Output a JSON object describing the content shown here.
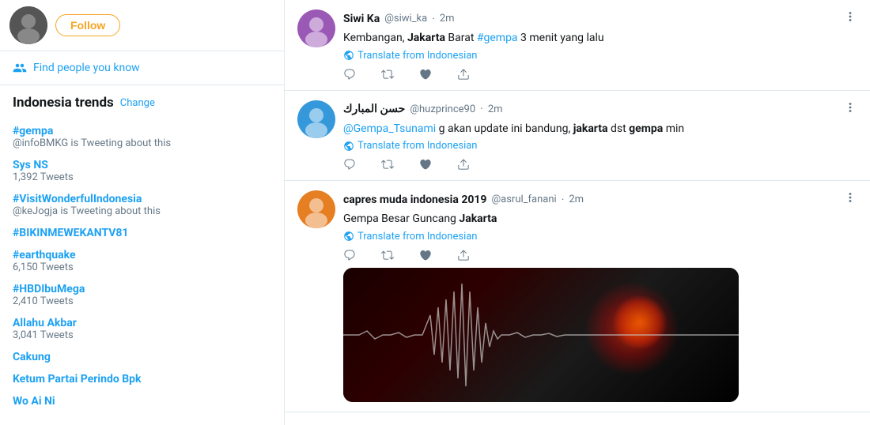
{
  "sidebar": {
    "follow_button": "Follow",
    "find_people": "Find people you know",
    "trends_title": "Indonesia trends",
    "trends_change": "Change",
    "trends": [
      {
        "label": "#gempa",
        "type": "hashtag",
        "sub": "@infoBMKG is Tweeting about this",
        "count": null
      },
      {
        "label": "Sys NS",
        "type": "plain",
        "sub": null,
        "count": "1,392 Tweets"
      },
      {
        "label": "#VisitWonderfulIndonesia",
        "type": "hashtag",
        "sub": "@keJogja is Tweeting about this",
        "count": null
      },
      {
        "label": "#BIKINMEWEKANTV81",
        "type": "hashtag",
        "sub": null,
        "count": null
      },
      {
        "label": "#earthquake",
        "type": "hashtag",
        "sub": null,
        "count": "6,150 Tweets"
      },
      {
        "label": "#HBDIbuMega",
        "type": "hashtag",
        "sub": null,
        "count": "2,410 Tweets"
      },
      {
        "label": "Allahu Akbar",
        "type": "plain",
        "sub": null,
        "count": "3,041 Tweets"
      },
      {
        "label": "Cakung",
        "type": "plain",
        "sub": null,
        "count": null
      },
      {
        "label": "Ketum Partai Perindo Bpk",
        "type": "plain",
        "sub": null,
        "count": null
      },
      {
        "label": "Wo Ai Ni",
        "type": "plain",
        "sub": null,
        "count": null
      }
    ]
  },
  "tweets": [
    {
      "id": 1,
      "name": "Siwi Ka",
      "handle": "@siwi_ka",
      "time": "2m",
      "text_parts": [
        {
          "text": "Kembangan, ",
          "type": "normal"
        },
        {
          "text": "Jakarta",
          "type": "bold"
        },
        {
          "text": " Barat ",
          "type": "normal"
        },
        {
          "text": "#gempa",
          "type": "hashtag"
        },
        {
          "text": " 3 menit yang lalu",
          "type": "normal"
        }
      ],
      "translate": "Translate from Indonesian",
      "has_image": false
    },
    {
      "id": 2,
      "name": "حسن المبارك",
      "handle": "@huzprince90",
      "time": "2m",
      "text_parts": [
        {
          "text": "@Gempa_Tsunami",
          "type": "mention"
        },
        {
          "text": " g akan update ini bandung, ",
          "type": "normal"
        },
        {
          "text": "jakarta",
          "type": "bold"
        },
        {
          "text": " dst ",
          "type": "normal"
        },
        {
          "text": "gempa",
          "type": "bold"
        },
        {
          "text": " min",
          "type": "normal"
        }
      ],
      "translate": "Translate from Indonesian",
      "has_image": false
    },
    {
      "id": 3,
      "name": "capres muda indonesia 2019",
      "handle": "@asrul_fanani",
      "time": "2m",
      "text_parts": [
        {
          "text": "Gempa Besar Guncang ",
          "type": "normal"
        },
        {
          "text": "Jakarta",
          "type": "bold"
        }
      ],
      "translate": "Translate from Indonesian",
      "has_image": true
    }
  ],
  "actions": {
    "reply": "reply",
    "retweet": "retweet",
    "like": "like",
    "dm": "direct message"
  }
}
